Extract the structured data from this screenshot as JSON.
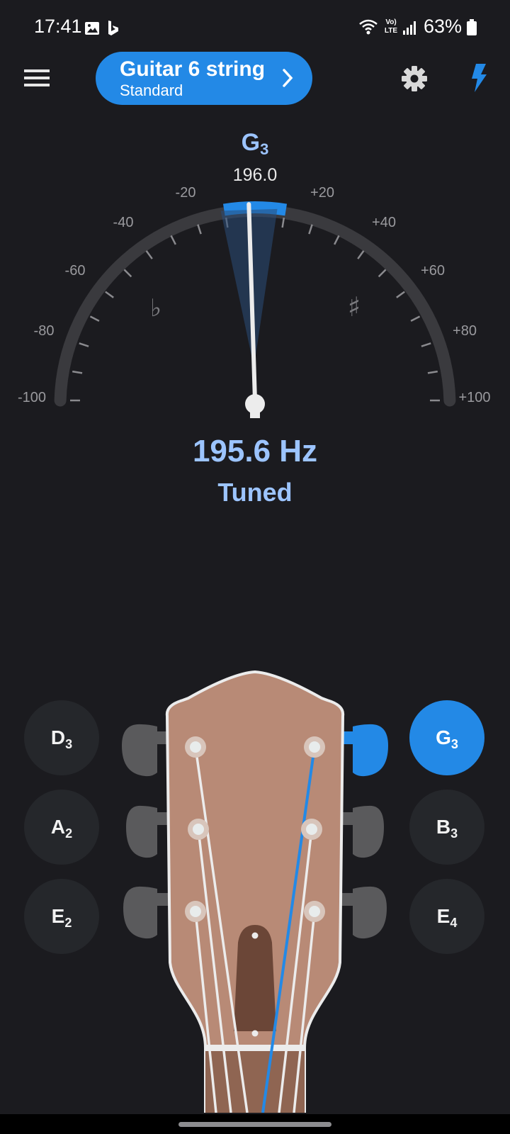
{
  "status_bar": {
    "time": "17:41",
    "battery": "63%",
    "network": "LTE"
  },
  "instrument": {
    "name": "Guitar 6 string",
    "tuning": "Standard"
  },
  "note": {
    "letter": "G",
    "octave": "3",
    "target_freq": "196.0"
  },
  "gauge": {
    "labels_left": [
      "-20",
      "-40",
      "-60",
      "-80",
      "-100"
    ],
    "labels_right": [
      "+20",
      "+40",
      "+60",
      "+80",
      "+100"
    ],
    "flat_symbol": "♭",
    "sharp_symbol": "♯",
    "needle_cents": -2
  },
  "readout": {
    "frequency": "195.6 Hz",
    "status": "Tuned"
  },
  "strings": [
    {
      "letter": "D",
      "octave": "3",
      "active": false
    },
    {
      "letter": "A",
      "octave": "2",
      "active": false
    },
    {
      "letter": "E",
      "octave": "2",
      "active": false
    },
    {
      "letter": "G",
      "octave": "3",
      "active": true
    },
    {
      "letter": "B",
      "octave": "3",
      "active": false
    },
    {
      "letter": "E",
      "octave": "4",
      "active": false
    }
  ],
  "colors": {
    "accent": "#2389e6",
    "note_text": "#9cc4ff",
    "headstock": "#b88a76",
    "background": "#1b1b1f"
  }
}
